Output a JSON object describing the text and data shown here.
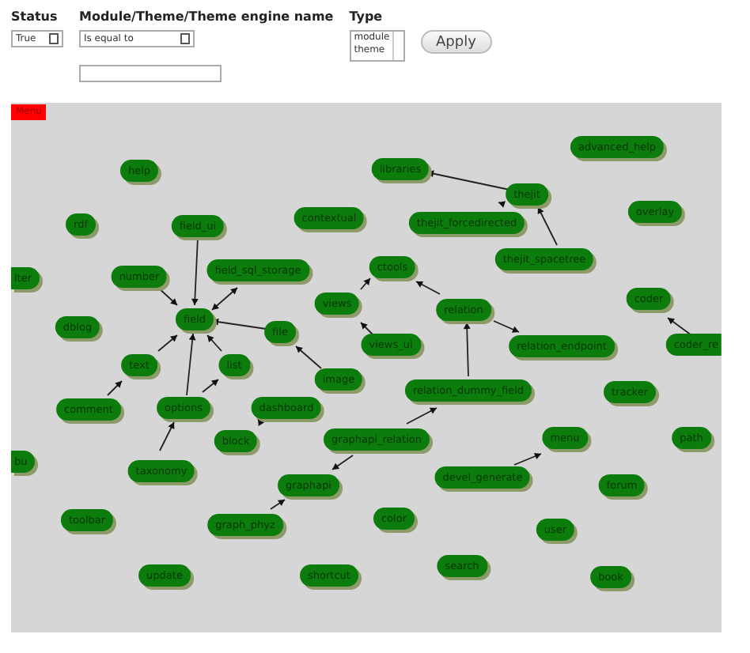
{
  "filters": {
    "status": {
      "label": "Status",
      "value": "True"
    },
    "name": {
      "label": "Module/Theme/Theme engine name",
      "operator": "Is equal to"
    },
    "type": {
      "label": "Type",
      "options": [
        {
          "label": "module",
          "selected": false
        },
        {
          "label": "theme",
          "selected": false
        }
      ]
    },
    "apply": "Apply"
  },
  "menu_button": "Menu",
  "graph": {
    "nodes": [
      {
        "label": "advanced_help"
      },
      {
        "label": "help"
      },
      {
        "label": "libraries"
      },
      {
        "label": "thejit"
      },
      {
        "label": "overlay"
      },
      {
        "label": "rdf"
      },
      {
        "label": "field_ui"
      },
      {
        "label": "contextual"
      },
      {
        "label": "thejit_forcedirected"
      },
      {
        "label": "thejit_spacetree"
      },
      {
        "label": "lter"
      },
      {
        "label": "number"
      },
      {
        "label": "field_sql_storage"
      },
      {
        "label": "ctools"
      },
      {
        "label": "views"
      },
      {
        "label": "relation"
      },
      {
        "label": "coder"
      },
      {
        "label": "dblog"
      },
      {
        "label": "field"
      },
      {
        "label": "file"
      },
      {
        "label": "views_ui"
      },
      {
        "label": "relation_endpoint"
      },
      {
        "label": "coder_re"
      },
      {
        "label": "text"
      },
      {
        "label": "list"
      },
      {
        "label": "image"
      },
      {
        "label": "relation_dummy_field"
      },
      {
        "label": "tracker"
      },
      {
        "label": "comment"
      },
      {
        "label": "options"
      },
      {
        "label": "dashboard"
      },
      {
        "label": "block"
      },
      {
        "label": "graphapi_relation"
      },
      {
        "label": "menu"
      },
      {
        "label": "path"
      },
      {
        "label": "bu"
      },
      {
        "label": "taxonomy"
      },
      {
        "label": "graphapi"
      },
      {
        "label": "devel_generate"
      },
      {
        "label": "forum"
      },
      {
        "label": "toolbar"
      },
      {
        "label": "graph_phyz"
      },
      {
        "label": "color"
      },
      {
        "label": "user"
      },
      {
        "label": "update"
      },
      {
        "label": "shortcut"
      },
      {
        "label": "search"
      },
      {
        "label": "book"
      }
    ]
  }
}
